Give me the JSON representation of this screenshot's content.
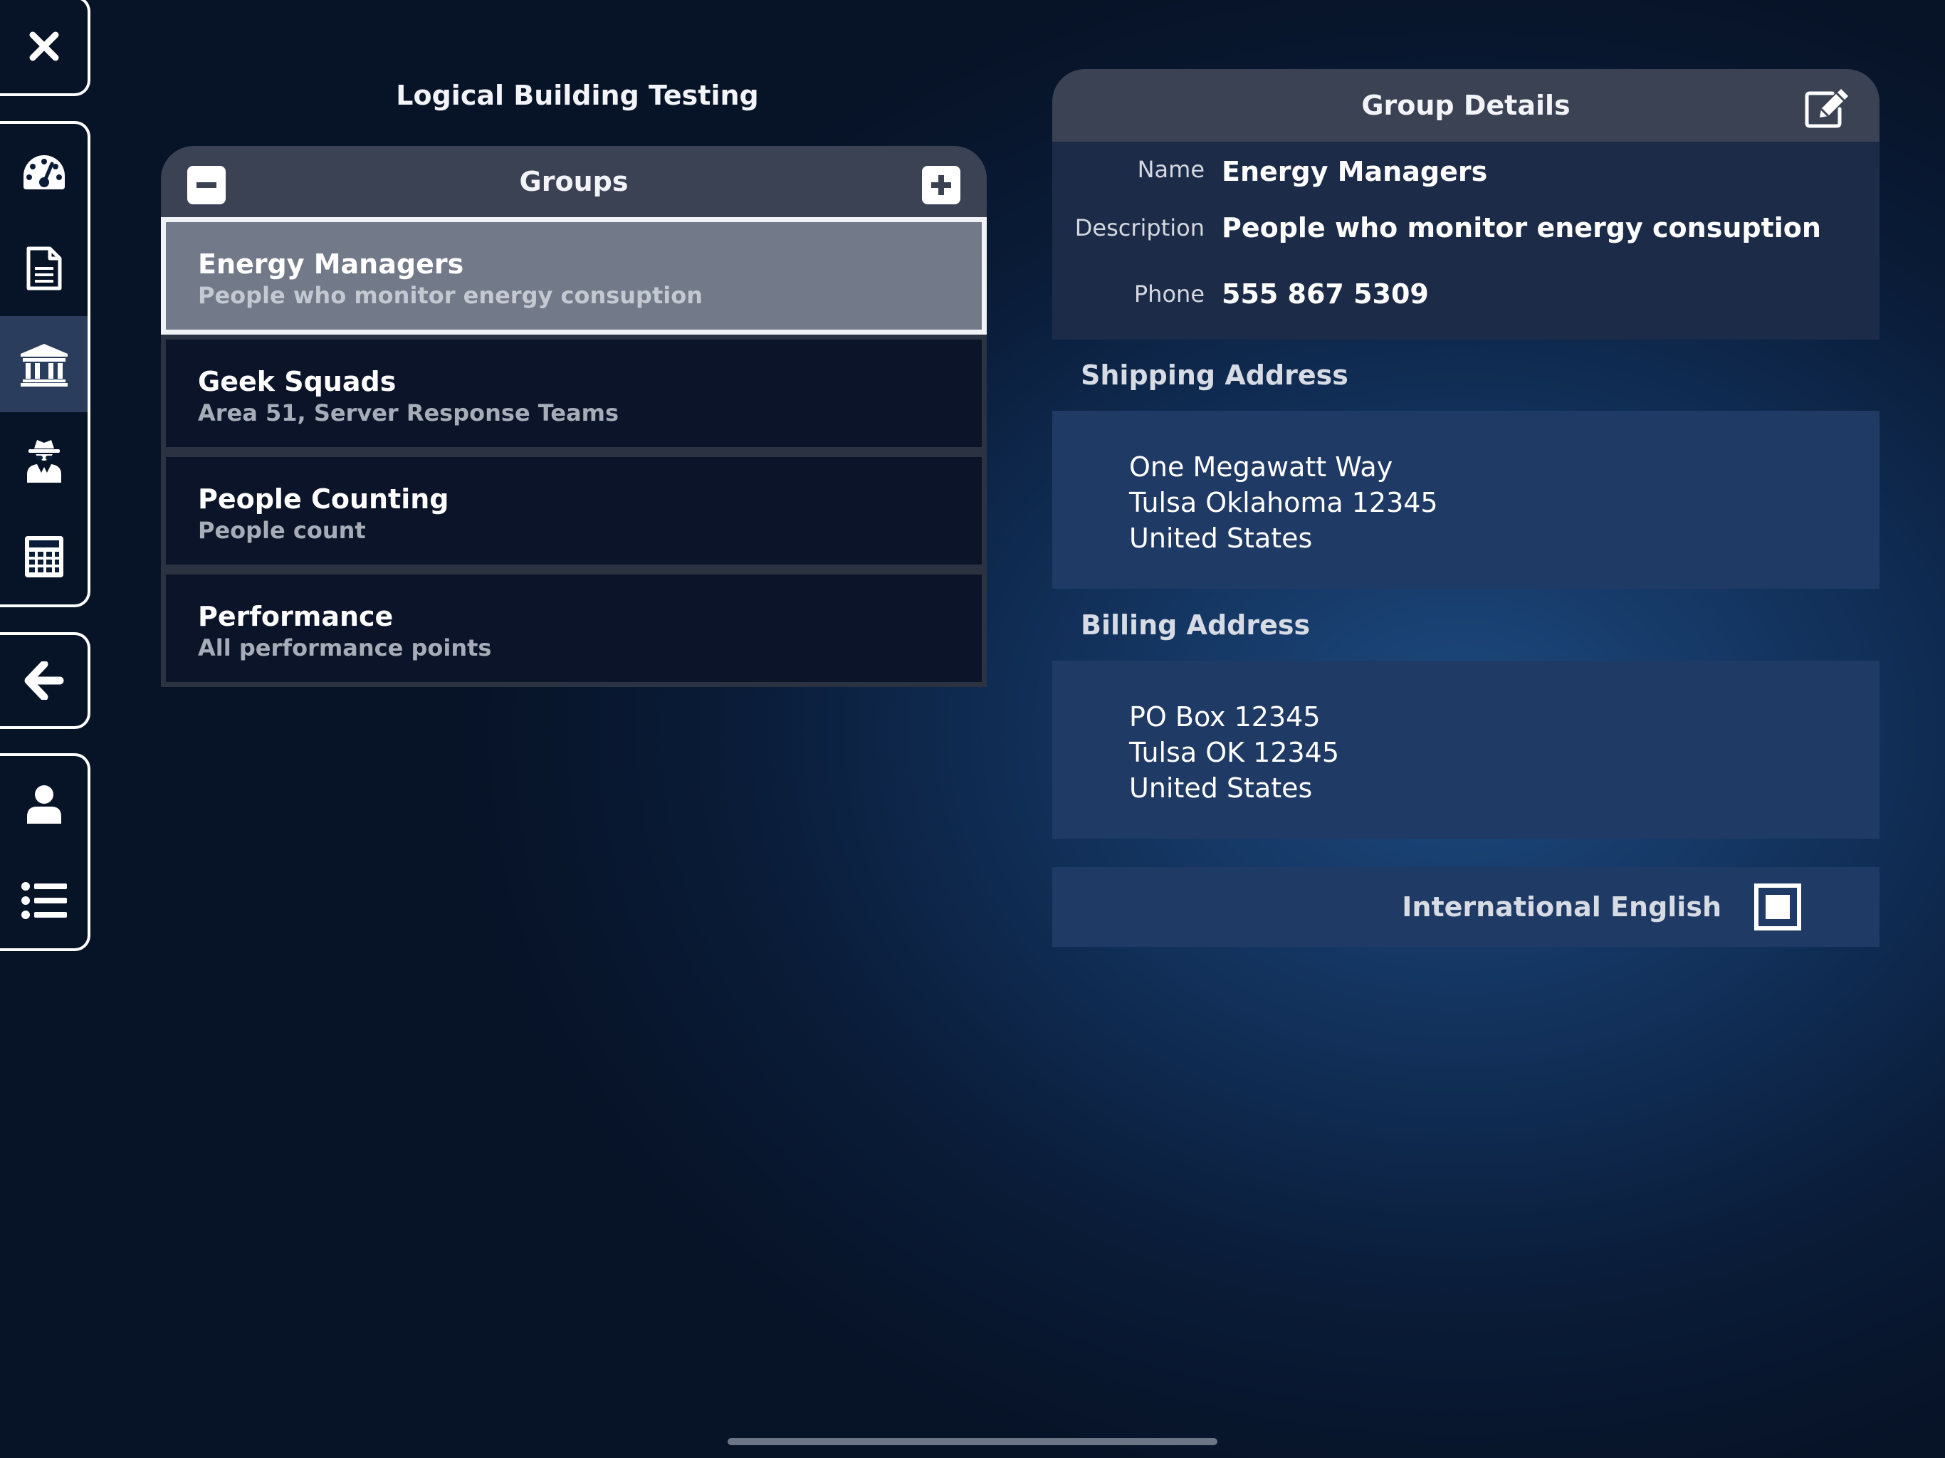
{
  "sidebar": {
    "close_icon": "close-icon",
    "nav_icons": [
      "dashboard-icon",
      "document-icon",
      "building-icon",
      "agent-icon",
      "calculator-icon"
    ],
    "active_nav": "building-icon",
    "back_icon": "back-arrow-icon",
    "bottom_icons": [
      "user-icon",
      "list-icon"
    ]
  },
  "page": {
    "title": "Logical Building Testing"
  },
  "groups": {
    "header": "Groups",
    "remove_icon": "minus-square-icon",
    "add_icon": "plus-square-icon",
    "items": [
      {
        "name": "Energy Managers",
        "description": "People who monitor energy consuption",
        "selected": true
      },
      {
        "name": "Geek Squads",
        "description": "Area 51, Server Response Teams",
        "selected": false
      },
      {
        "name": "People Counting",
        "description": "People count",
        "selected": false
      },
      {
        "name": "Performance",
        "description": "All performance points",
        "selected": false
      }
    ]
  },
  "details": {
    "header": "Group Details",
    "edit_icon": "edit-icon",
    "fields": {
      "name_label": "Name",
      "name_value": "Energy Managers",
      "description_label": "Description",
      "description_value": "People who monitor energy consuption",
      "phone_label": "Phone",
      "phone_value": "555 867 5309"
    },
    "shipping": {
      "title": "Shipping Address",
      "lines": [
        "One Megawatt Way",
        "Tulsa Oklahoma 12345",
        "United States"
      ]
    },
    "billing": {
      "title": "Billing Address",
      "lines": [
        "PO Box 12345",
        "Tulsa OK 12345",
        "United States"
      ]
    },
    "international": {
      "label": "International English",
      "checked": true
    }
  },
  "colors": {
    "background": "#0a1c38",
    "panel_header": "#3a4254",
    "selected_row": "#727a89",
    "address_block": "#1f3a64"
  }
}
